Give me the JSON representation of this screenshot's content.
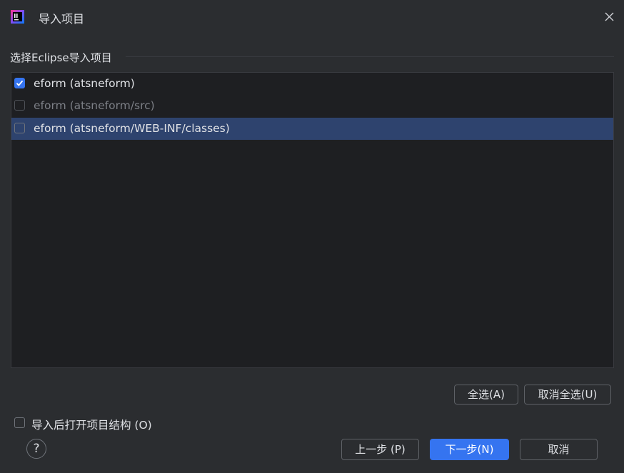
{
  "window": {
    "title": "导入项目"
  },
  "section_title": "选择Eclipse导入项目",
  "projects": [
    {
      "label": "eform (atsneform)",
      "checked": true,
      "enabled": true,
      "selected": false
    },
    {
      "label": "eform (atsneform/src)",
      "checked": false,
      "enabled": false,
      "selected": false
    },
    {
      "label": "eform (atsneform/WEB-INF/classes)",
      "checked": false,
      "enabled": true,
      "selected": true
    }
  ],
  "select_all_label": "全选(A)",
  "deselect_all_label": "取消全选(U)",
  "open_structure_label": "导入后打开项目结构 (O)",
  "help_label": "?",
  "buttons": {
    "previous": "上一步 (P)",
    "next": "下一步(N)",
    "cancel": "取消"
  },
  "colors": {
    "accent": "#3574f0",
    "background": "#2b2d30",
    "selection": "#2e436e"
  }
}
